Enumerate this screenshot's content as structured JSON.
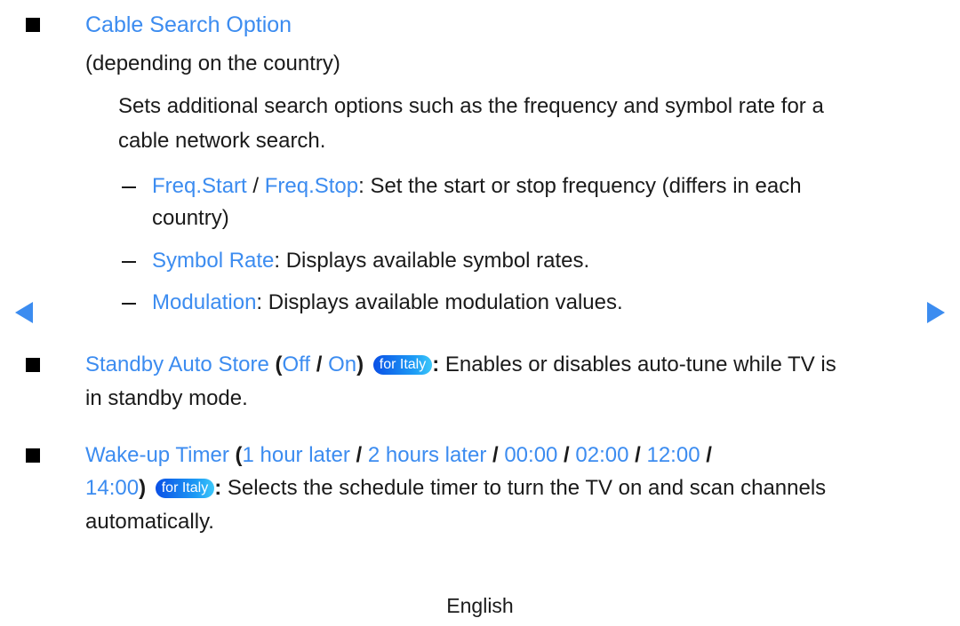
{
  "nav": {
    "prev_icon": "triangle-left",
    "next_icon": "triangle-right",
    "accent_color": "#3c8cf0"
  },
  "sections": [
    {
      "title": "Cable Search Option",
      "subtitle": "(depending on the country)",
      "description_lines": [
        "Sets additional search options such as the frequency and symbol rate for a",
        "cable network search."
      ],
      "items": [
        {
          "term1": "Freq.Start",
          "separator": " / ",
          "term2": "Freq.Stop",
          "text_line1": ": Set the start or stop frequency (differs in each",
          "text_line2": "country)"
        },
        {
          "term": "Symbol Rate",
          "text": ": Displays available symbol rates."
        },
        {
          "term": "Modulation",
          "text": ": Displays available modulation values."
        }
      ]
    },
    {
      "title": "Standby Auto Store",
      "open_paren": " (",
      "options": [
        "Off",
        "On"
      ],
      "option_sep": " / ",
      "close_paren": ")",
      "badge": "for Italy",
      "colon": ":",
      "text_line1": " Enables or disables auto-tune while TV is",
      "text_line2": "in standby mode."
    },
    {
      "title": "Wake-up Timer",
      "open_paren": " (",
      "options": [
        "1 hour later",
        "2 hours later",
        "00:00",
        "02:00",
        "12:00",
        "14:00"
      ],
      "option_sep": " / ",
      "trailing_sep": " /",
      "close_paren": ")",
      "badge": "for Italy",
      "colon": ":",
      "text_line1": " Selects the schedule timer to turn the TV on and scan channels",
      "text_line2": "automatically."
    }
  ],
  "footer": {
    "language": "English"
  }
}
